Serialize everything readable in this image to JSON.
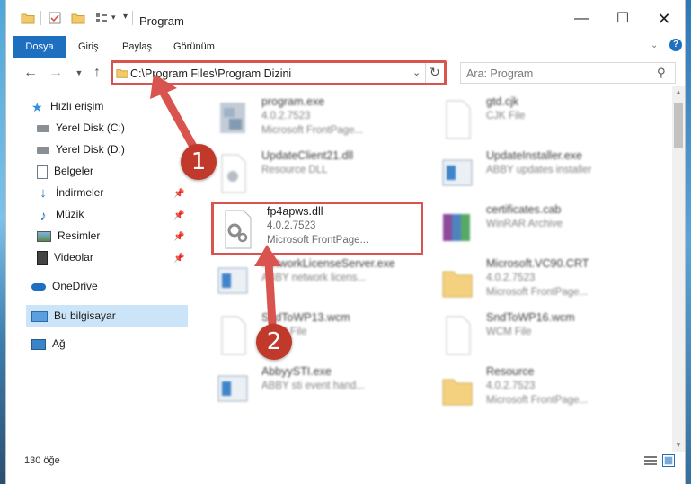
{
  "window": {
    "title": "Program"
  },
  "ribbon": {
    "tabs": [
      "Dosya",
      "Giriş",
      "Paylaş",
      "Görünüm"
    ]
  },
  "address": {
    "path": "C:\\Program Files\\Program Dizini",
    "search_placeholder": "Ara: Program"
  },
  "sidebar": {
    "items": [
      {
        "label": "Hızlı erişim",
        "icon": "star-icon"
      },
      {
        "label": "Yerel Disk (C:)",
        "icon": "drive-icon"
      },
      {
        "label": "Yerel Disk (D:)",
        "icon": "drive-icon"
      },
      {
        "label": "Belgeler",
        "icon": "documents-icon"
      },
      {
        "label": "İndirmeler",
        "icon": "download-icon"
      },
      {
        "label": "Müzik",
        "icon": "music-icon"
      },
      {
        "label": "Resimler",
        "icon": "pictures-icon"
      },
      {
        "label": "Videolar",
        "icon": "video-icon"
      },
      {
        "label": "OneDrive",
        "icon": "cloud-icon"
      },
      {
        "label": "Bu bilgisayar",
        "icon": "computer-icon"
      },
      {
        "label": "Ağ",
        "icon": "network-icon"
      }
    ]
  },
  "files": [
    {
      "name": "program.exe",
      "l2": "4.0.2.7523",
      "l3": "Microsoft FrontPage..."
    },
    {
      "name": "gtd.cjk",
      "l2": "CJK File",
      "l3": ""
    },
    {
      "name": "UpdateClient21.dll",
      "l2": "Resource DLL",
      "l3": ""
    },
    {
      "name": "UpdateInstaller.exe",
      "l2": "ABBY updates installer",
      "l3": ""
    },
    {
      "name": "fp4apws.dll",
      "l2": "4.0.2.7523",
      "l3": "Microsoft FrontPage..."
    },
    {
      "name": "certificates.cab",
      "l2": "WinRAR Archive",
      "l3": ""
    },
    {
      "name": "NetworkLicenseServer.exe",
      "l2": "ABBY network licens...",
      "l3": ""
    },
    {
      "name": "Microsoft.VC90.CRT",
      "l2": "4.0.2.7523",
      "l3": "Microsoft FrontPage..."
    },
    {
      "name": "SndToWP13.wcm",
      "l2": "WCM File",
      "l3": ""
    },
    {
      "name": "SndToWP16.wcm",
      "l2": "WCM File",
      "l3": ""
    },
    {
      "name": "AbbyySTI.exe",
      "l2": "ABBY sti event hand...",
      "l3": ""
    },
    {
      "name": "Resource",
      "l2": "4.0.2.7523",
      "l3": "Microsoft FrontPage..."
    }
  ],
  "status": {
    "count": "130 öğe"
  },
  "badges": [
    "1",
    "2"
  ],
  "colors": {
    "accent": "#1f6fc1",
    "highlight": "#d9534f",
    "selected": "#cce4f7"
  }
}
